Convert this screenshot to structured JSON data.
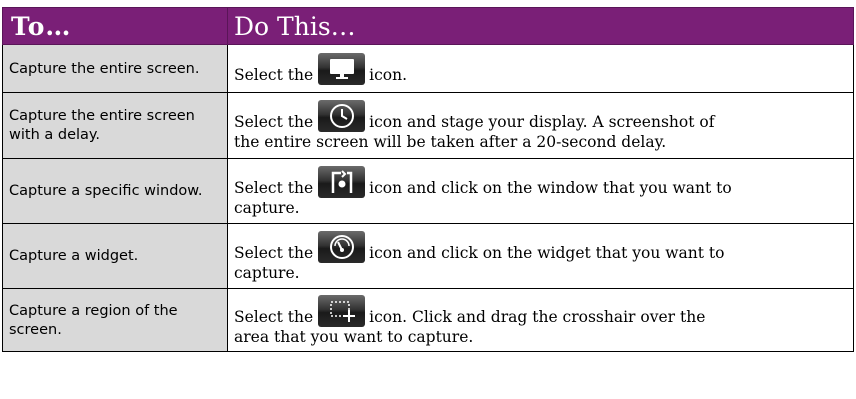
{
  "header": {
    "col1": "To…",
    "col2": "Do This…"
  },
  "rows": [
    {
      "task": "Capture the entire screen.",
      "before": "Select the",
      "icon": "monitor-icon",
      "after": "icon.",
      "rest": ""
    },
    {
      "task": "Capture the entire screen with a delay.",
      "before": "Select the",
      "icon": "clock-icon",
      "after": "icon and stage your display. A screenshot of",
      "rest": "the entire screen will be taken after a 20-second delay."
    },
    {
      "task": "Capture a specific window.",
      "before": "Select the",
      "icon": "window-capture-icon",
      "after": "icon and click on the window that you want to",
      "rest": "capture."
    },
    {
      "task": "Capture a widget.",
      "before": "Select the",
      "icon": "widget-gauge-icon",
      "after": "icon and click on the widget that you want to",
      "rest": "capture."
    },
    {
      "task": "Capture a region of the screen.",
      "before": "Select the",
      "icon": "region-crosshair-icon",
      "after": "icon. Click and drag the crosshair over the",
      "rest": "area that you want to capture."
    }
  ],
  "colors": {
    "header_bg": "#7a1f77",
    "task_bg": "#d9d9d9"
  }
}
